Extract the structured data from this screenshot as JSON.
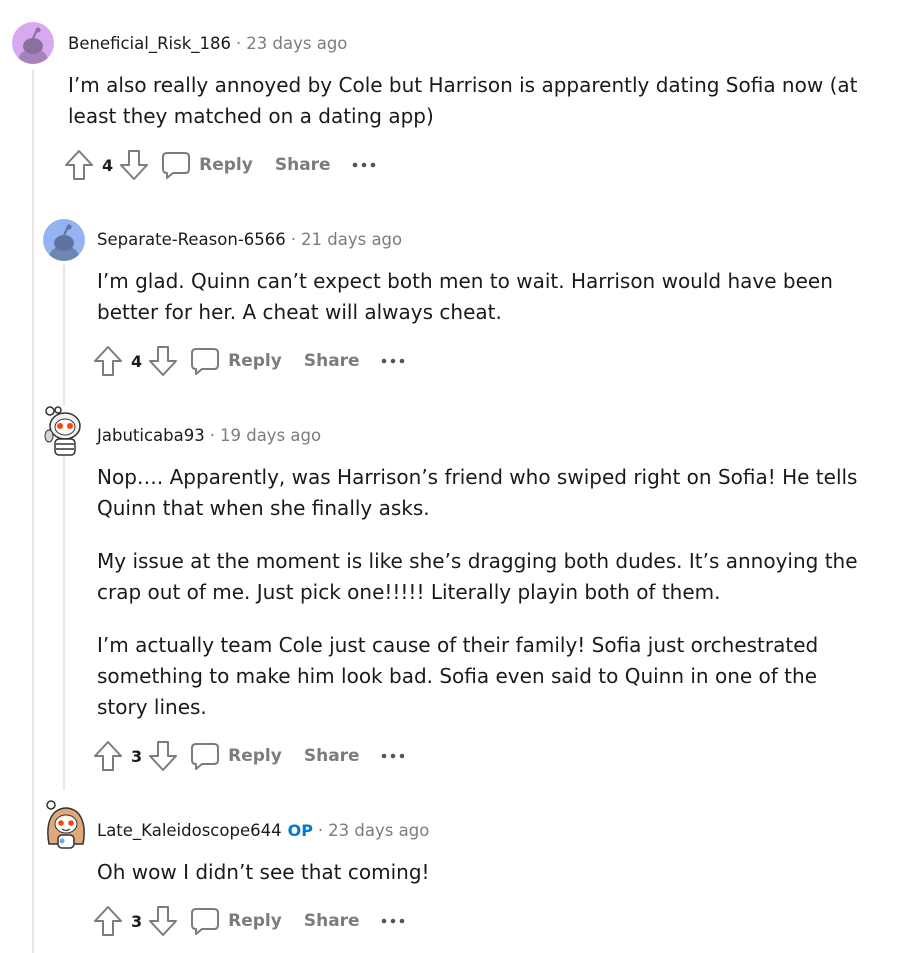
{
  "comments": [
    {
      "author": "Beneficial_Risk_186",
      "op": "",
      "time": "23 days ago",
      "paragraphs": [
        "I’m also really annoyed by Cole but Harrison is apparently dating Sofia now (at least they matched on a dating app)"
      ],
      "score": "4",
      "reply_label": "Reply",
      "share_label": "Share",
      "avatar_icon": "snoo-avatar-icon",
      "avatar_color": "#d9a9f0"
    },
    {
      "author": "Separate-Reason-6566",
      "op": "",
      "time": "21 days ago",
      "paragraphs": [
        "I’m glad. Quinn can’t expect both men to wait. Harrison would have been better for her. A cheat will always cheat."
      ],
      "score": "4",
      "reply_label": "Reply",
      "share_label": "Share",
      "avatar_icon": "snoo-avatar-icon",
      "avatar_color": "#94b3f0"
    },
    {
      "author": "Jabuticaba93",
      "op": "",
      "time": "19 days ago",
      "paragraphs": [
        "Nop…. Apparently, was Harrison’s friend who swiped right on Sofia! He tells Quinn that when she finally asks.",
        "My issue at the moment is like she’s dragging both dudes. It’s annoying the crap out of me. Just pick one!!!!! Literally playin both of them.",
        "I’m actually team Cole just cause of their family! Sofia just orchestrated something to make him look bad. Sofia even said to Quinn in one of the story lines."
      ],
      "score": "3",
      "reply_label": "Reply",
      "share_label": "Share",
      "avatar_icon": "snoo-astronaut-avatar-icon",
      "avatar_color": "#ffffff"
    },
    {
      "author": "Late_Kaleidoscope644",
      "op": "OP",
      "time": "23 days ago",
      "paragraphs": [
        "Oh wow I didn’t see that coming!"
      ],
      "score": "3",
      "reply_label": "Reply",
      "share_label": "Share",
      "avatar_icon": "snoo-hair-avatar-icon",
      "avatar_color": "#ffffff"
    }
  ],
  "colors": {
    "op": "#0079d3",
    "muted": "#7c7c7c",
    "text": "#1a1a1b",
    "thread_line": "#e5e5e5"
  }
}
